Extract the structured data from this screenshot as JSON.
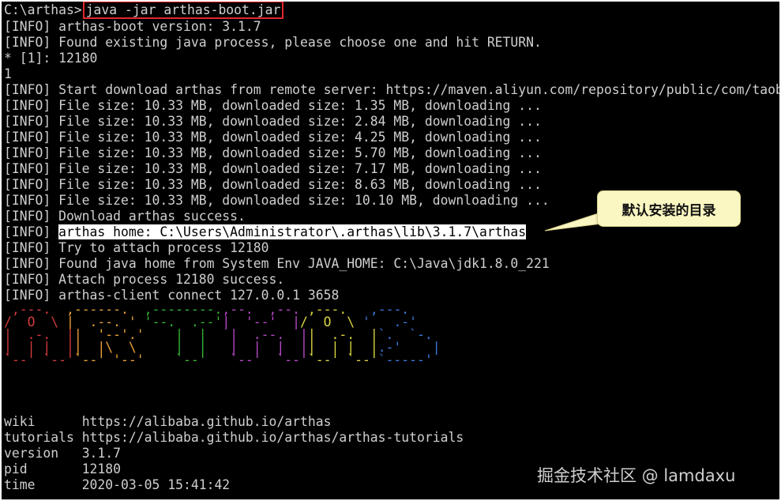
{
  "terminal": {
    "prompt": "C:\\arthas>",
    "command": "java -jar arthas-boot.jar",
    "lines": [
      "[INFO] arthas-boot version: 3.1.7",
      "[INFO] Found existing java process, please choose one and hit RETURN.",
      "* [1]: 12180",
      "1",
      "[INFO] Start download arthas from remote server: https://maven.aliyun.com/repository/public/com/taobao/arthas/arthas-packaging/3.1.7/arthas-packaging-3.1.7-bin.zip",
      "[INFO] File size: 10.33 MB, downloaded size: 1.35 MB, downloading ...",
      "[INFO] File size: 10.33 MB, downloaded size: 2.84 MB, downloading ...",
      "[INFO] File size: 10.33 MB, downloaded size: 4.25 MB, downloading ...",
      "[INFO] File size: 10.33 MB, downloaded size: 5.70 MB, downloading ...",
      "[INFO] File size: 10.33 MB, downloaded size: 7.17 MB, downloading ...",
      "[INFO] File size: 10.33 MB, downloaded size: 8.63 MB, downloading ...",
      "[INFO] File size: 10.33 MB, downloaded size: 10.10 MB, downloading ...",
      "[INFO] Download arthas success."
    ],
    "home_prefix": "[INFO] ",
    "home_path": "arthas home: C:\\Users\\Administrator\\.arthas\\lib\\3.1.7\\arthas",
    "lines_after": [
      "[INFO] Try to attach process 12180",
      "[INFO] Found java home from System Env JAVA_HOME: C:\\Java\\jdk1.8.0_221",
      "[INFO] Attach process 12180 success.",
      "[INFO] arthas-client connect 127.0.0.1 3658"
    ],
    "logo": {
      "rows": [
        [
          " ,---.  ",
          ",------.  ",
          ",--------.",
          ",--.  ,--.",
          " ,---.  ",
          " ,---.   "
        ],
        [
          "/  O  \\ ",
          "|  .--. ' ",
          "'--.  .--'",
          "|  '--'  |",
          "/  O  \\ ",
          "'   .-'  "
        ],
        [
          "|  .-.  |",
          "|  '--'.' ",
          "   |  |   ",
          "|  .--.  |",
          "|  .-.  |",
          "`.  `-.  "
        ],
        [
          "|  | |  |",
          "|  |\\  \\  ",
          "   |  |   ",
          "|  |  |  |",
          "|  | |  |",
          ".-'    | "
        ],
        [
          "`--' `--'",
          "`--' '--' ",
          "   `--'   ",
          "`--'  `--'",
          "`--' `--'",
          "`-----'  "
        ]
      ],
      "colors": [
        "#d23b3b",
        "#e8a03a",
        "#34b434",
        "#b548c6",
        "#d8d440",
        "#3c78d8"
      ]
    },
    "info": [
      {
        "key": "wiki      ",
        "value": "https://alibaba.github.io/arthas"
      },
      {
        "key": "tutorials ",
        "value": "https://alibaba.github.io/arthas/arthas-tutorials"
      },
      {
        "key": "version   ",
        "value": "3.1.7"
      },
      {
        "key": "pid       ",
        "value": "12180"
      },
      {
        "key": "time      ",
        "value": "2020-03-05 15:41:42"
      }
    ]
  },
  "callout": {
    "text": "默认安装的目录"
  },
  "watermark": {
    "text": "掘金技术社区 @ lamdaxu"
  },
  "colors": {
    "terminal_bg": "#000000",
    "terminal_text": "#cfcfcf",
    "command_box": "#e3262b",
    "callout_bg": "#fbf7c2"
  }
}
